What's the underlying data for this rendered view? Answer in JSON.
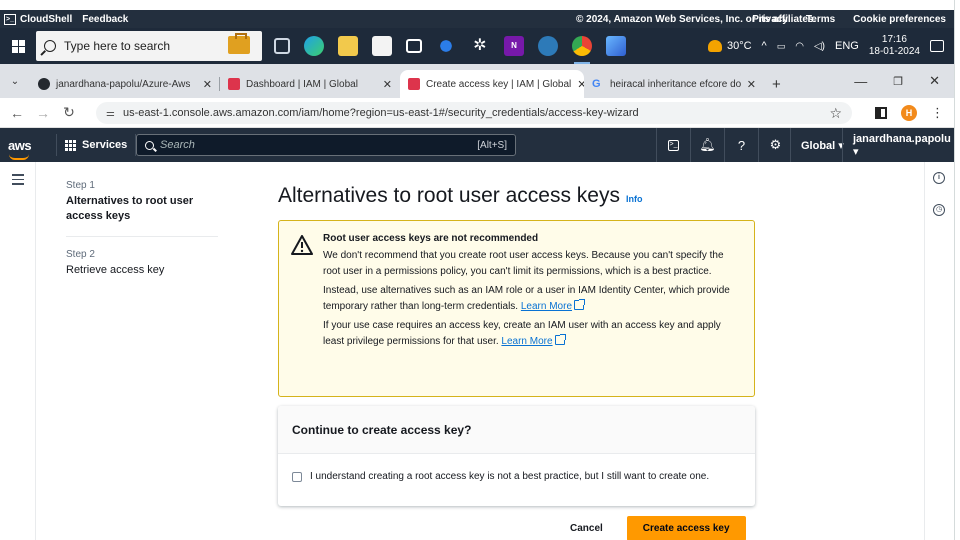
{
  "cloudshell_bar": {
    "cloudshell_label": "CloudShell",
    "feedback_label": "Feedback",
    "copyright": "© 2024, Amazon Web Services, Inc. or its affiliates.",
    "privacy": "Privacy",
    "terms": "Terms",
    "cookies": "Cookie preferences"
  },
  "taskbar": {
    "search_placeholder": "Type here to search",
    "weather": "30°C",
    "lang": "ENG",
    "time": "17:16",
    "date": "18-01-2024"
  },
  "tabs": [
    {
      "label": "janardhana-papolu/Azure-Aws",
      "fav_color": "#24292f"
    },
    {
      "label": "Dashboard | IAM | Global",
      "fav_color": "#dd344c"
    },
    {
      "label": "Create access key | IAM | Global",
      "fav_color": "#dd344c"
    },
    {
      "label": "heiracal inheritance efcore dont",
      "fav_color": "#4285f4"
    }
  ],
  "address": {
    "url": "us-east-1.console.aws.amazon.com/iam/home?region=us-east-1#/security_credentials/access-key-wizard",
    "profile_initial": "H"
  },
  "aws_nav": {
    "logo": "aws",
    "services": "Services",
    "search_placeholder": "Search",
    "search_shortcut": "[Alt+S]",
    "region": "Global ▾",
    "account": "janardhana.papolu ▾"
  },
  "wizard": {
    "steps": [
      {
        "number": "Step 1",
        "title": "Alternatives to root user access keys"
      },
      {
        "number": "Step 2",
        "title": "Retrieve access key"
      }
    ],
    "page_title": "Alternatives to root user access keys",
    "info_link": "Info",
    "alert": {
      "title": "Root user access keys are not recommended",
      "p1": "We don't recommend that you create root user access keys. Because you can't specify the root user in a permissions policy, you can't limit its permissions, which is a best practice.",
      "p2": "Instead, use alternatives such as an IAM role or a user in IAM Identity Center, which provide temporary rather than long-term credentials.",
      "p2_link": "Learn More",
      "p3": "If your use case requires an access key, create an IAM user with an access key and apply least privilege permissions for that user.",
      "p3_link": "Learn More"
    },
    "continue_header": "Continue to create access key?",
    "checkbox_label": "I understand creating a root access key is not a best practice, but I still want to create one.",
    "cancel": "Cancel",
    "create": "Create access key"
  },
  "colors": {
    "aws_nav_bg": "#232f3e",
    "primary_button": "#ff9900",
    "link": "#0972d3",
    "alert_bg": "#fffce9",
    "alert_border": "#d5b31b"
  }
}
